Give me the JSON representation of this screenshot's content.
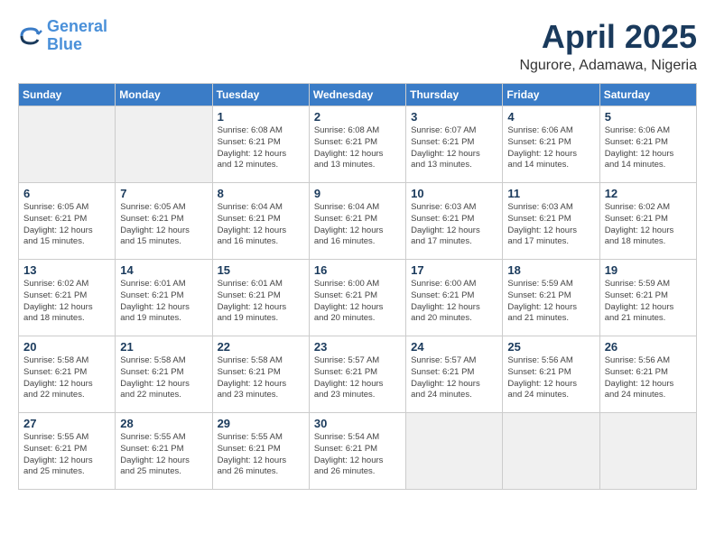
{
  "header": {
    "logo_line1": "General",
    "logo_line2": "Blue",
    "title": "April 2025",
    "subtitle": "Ngurore, Adamawa, Nigeria"
  },
  "weekdays": [
    "Sunday",
    "Monday",
    "Tuesday",
    "Wednesday",
    "Thursday",
    "Friday",
    "Saturday"
  ],
  "weeks": [
    [
      {
        "day": "",
        "info": ""
      },
      {
        "day": "",
        "info": ""
      },
      {
        "day": "1",
        "info": "Sunrise: 6:08 AM\nSunset: 6:21 PM\nDaylight: 12 hours\nand 12 minutes."
      },
      {
        "day": "2",
        "info": "Sunrise: 6:08 AM\nSunset: 6:21 PM\nDaylight: 12 hours\nand 13 minutes."
      },
      {
        "day": "3",
        "info": "Sunrise: 6:07 AM\nSunset: 6:21 PM\nDaylight: 12 hours\nand 13 minutes."
      },
      {
        "day": "4",
        "info": "Sunrise: 6:06 AM\nSunset: 6:21 PM\nDaylight: 12 hours\nand 14 minutes."
      },
      {
        "day": "5",
        "info": "Sunrise: 6:06 AM\nSunset: 6:21 PM\nDaylight: 12 hours\nand 14 minutes."
      }
    ],
    [
      {
        "day": "6",
        "info": "Sunrise: 6:05 AM\nSunset: 6:21 PM\nDaylight: 12 hours\nand 15 minutes."
      },
      {
        "day": "7",
        "info": "Sunrise: 6:05 AM\nSunset: 6:21 PM\nDaylight: 12 hours\nand 15 minutes."
      },
      {
        "day": "8",
        "info": "Sunrise: 6:04 AM\nSunset: 6:21 PM\nDaylight: 12 hours\nand 16 minutes."
      },
      {
        "day": "9",
        "info": "Sunrise: 6:04 AM\nSunset: 6:21 PM\nDaylight: 12 hours\nand 16 minutes."
      },
      {
        "day": "10",
        "info": "Sunrise: 6:03 AM\nSunset: 6:21 PM\nDaylight: 12 hours\nand 17 minutes."
      },
      {
        "day": "11",
        "info": "Sunrise: 6:03 AM\nSunset: 6:21 PM\nDaylight: 12 hours\nand 17 minutes."
      },
      {
        "day": "12",
        "info": "Sunrise: 6:02 AM\nSunset: 6:21 PM\nDaylight: 12 hours\nand 18 minutes."
      }
    ],
    [
      {
        "day": "13",
        "info": "Sunrise: 6:02 AM\nSunset: 6:21 PM\nDaylight: 12 hours\nand 18 minutes."
      },
      {
        "day": "14",
        "info": "Sunrise: 6:01 AM\nSunset: 6:21 PM\nDaylight: 12 hours\nand 19 minutes."
      },
      {
        "day": "15",
        "info": "Sunrise: 6:01 AM\nSunset: 6:21 PM\nDaylight: 12 hours\nand 19 minutes."
      },
      {
        "day": "16",
        "info": "Sunrise: 6:00 AM\nSunset: 6:21 PM\nDaylight: 12 hours\nand 20 minutes."
      },
      {
        "day": "17",
        "info": "Sunrise: 6:00 AM\nSunset: 6:21 PM\nDaylight: 12 hours\nand 20 minutes."
      },
      {
        "day": "18",
        "info": "Sunrise: 5:59 AM\nSunset: 6:21 PM\nDaylight: 12 hours\nand 21 minutes."
      },
      {
        "day": "19",
        "info": "Sunrise: 5:59 AM\nSunset: 6:21 PM\nDaylight: 12 hours\nand 21 minutes."
      }
    ],
    [
      {
        "day": "20",
        "info": "Sunrise: 5:58 AM\nSunset: 6:21 PM\nDaylight: 12 hours\nand 22 minutes."
      },
      {
        "day": "21",
        "info": "Sunrise: 5:58 AM\nSunset: 6:21 PM\nDaylight: 12 hours\nand 22 minutes."
      },
      {
        "day": "22",
        "info": "Sunrise: 5:58 AM\nSunset: 6:21 PM\nDaylight: 12 hours\nand 23 minutes."
      },
      {
        "day": "23",
        "info": "Sunrise: 5:57 AM\nSunset: 6:21 PM\nDaylight: 12 hours\nand 23 minutes."
      },
      {
        "day": "24",
        "info": "Sunrise: 5:57 AM\nSunset: 6:21 PM\nDaylight: 12 hours\nand 24 minutes."
      },
      {
        "day": "25",
        "info": "Sunrise: 5:56 AM\nSunset: 6:21 PM\nDaylight: 12 hours\nand 24 minutes."
      },
      {
        "day": "26",
        "info": "Sunrise: 5:56 AM\nSunset: 6:21 PM\nDaylight: 12 hours\nand 24 minutes."
      }
    ],
    [
      {
        "day": "27",
        "info": "Sunrise: 5:55 AM\nSunset: 6:21 PM\nDaylight: 12 hours\nand 25 minutes."
      },
      {
        "day": "28",
        "info": "Sunrise: 5:55 AM\nSunset: 6:21 PM\nDaylight: 12 hours\nand 25 minutes."
      },
      {
        "day": "29",
        "info": "Sunrise: 5:55 AM\nSunset: 6:21 PM\nDaylight: 12 hours\nand 26 minutes."
      },
      {
        "day": "30",
        "info": "Sunrise: 5:54 AM\nSunset: 6:21 PM\nDaylight: 12 hours\nand 26 minutes."
      },
      {
        "day": "",
        "info": ""
      },
      {
        "day": "",
        "info": ""
      },
      {
        "day": "",
        "info": ""
      }
    ]
  ]
}
